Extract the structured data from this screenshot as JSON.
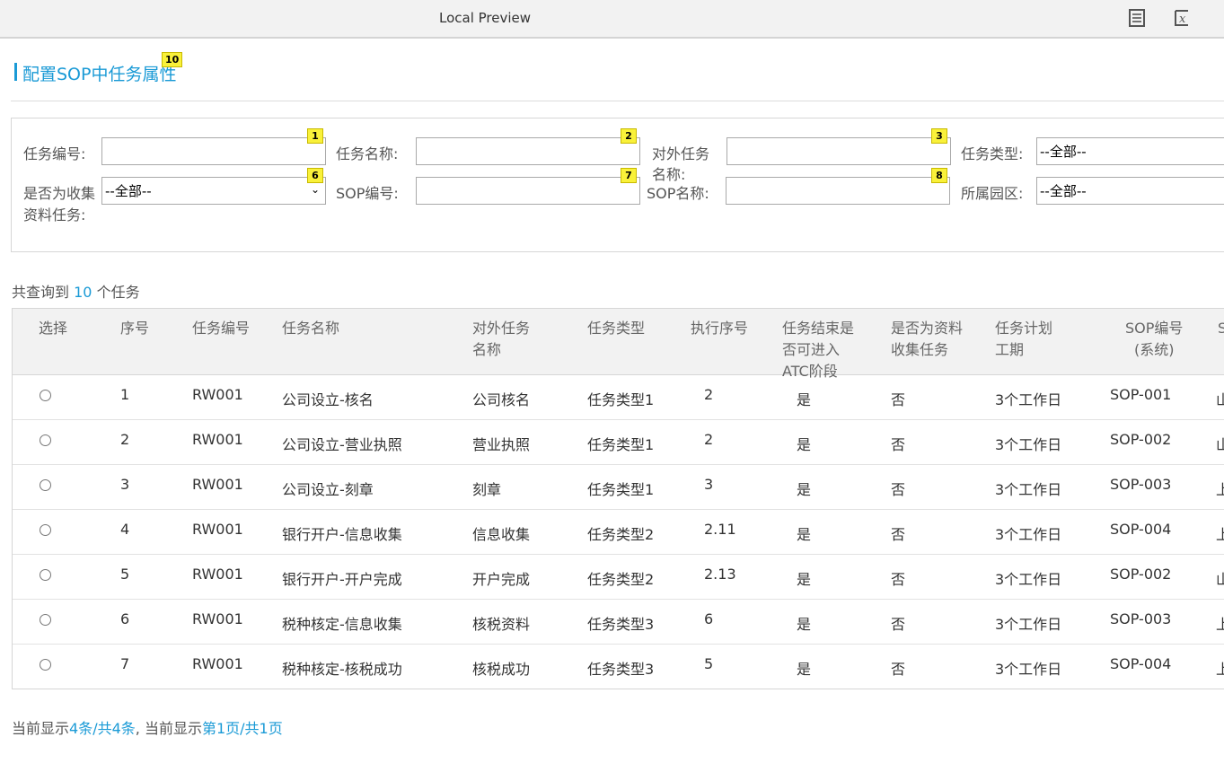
{
  "window": {
    "title": "Local Preview",
    "list_icon": "document-list-icon",
    "close_icon": "close-formula-icon"
  },
  "page": {
    "title": "配置SOP中任务属性",
    "title_badge": "10"
  },
  "search": {
    "task_no": {
      "label": "任务编号:",
      "value": "",
      "badge": "1"
    },
    "task_name": {
      "label": "任务名称:",
      "value": "",
      "badge": "2"
    },
    "external_task_name": {
      "label_line1": "对外任务",
      "label_line2": "名称:",
      "value": "",
      "badge": "3"
    },
    "task_type": {
      "label": "任务类型:",
      "selected": "--全部--"
    },
    "is_collect_task": {
      "label_line1": "是否为收集",
      "label_line2": "资料任务:",
      "selected": "--全部--",
      "badge": "6"
    },
    "sop_no": {
      "label": "SOP编号:",
      "value": "",
      "badge": "7"
    },
    "sop_name": {
      "label": "SOP名称:",
      "value": "",
      "badge": "8"
    },
    "park": {
      "label": "所属园区:",
      "selected": "--全部--"
    }
  },
  "result_count": {
    "prefix": "共查询到",
    "count": "10",
    "suffix": "个任务"
  },
  "table": {
    "headers": {
      "select": "选择",
      "seq": "序号",
      "task_no": "任务编号",
      "task_name": "任务名称",
      "external_name_1": "对外任务",
      "external_name_2": "名称",
      "task_type": "任务类型",
      "exec_seq": "执行序号",
      "atc_1": "任务结束是",
      "atc_2": "否可进入",
      "atc_3": "ATC阶段",
      "collect_1": "是否为资料",
      "collect_2": "收集任务",
      "period_1": "任务计划",
      "period_2": "工期",
      "sop_no_1": "SOP编号",
      "sop_no_2": "(系统)",
      "next": "S"
    },
    "rows": [
      {
        "seq": "1",
        "task_no": "RW001",
        "task_name": "公司设立-核名",
        "external_name": "公司核名",
        "task_type": "任务类型1",
        "exec_seq": "2",
        "atc": "是",
        "collect": "否",
        "period": "3个工作日",
        "sop_no": "SOP-001",
        "next": "山"
      },
      {
        "seq": "2",
        "task_no": "RW001",
        "task_name": "公司设立-营业执照",
        "external_name": "营业执照",
        "task_type": "任务类型1",
        "exec_seq": "2",
        "atc": "是",
        "collect": "否",
        "period": "3个工作日",
        "sop_no": "SOP-002",
        "next": "山"
      },
      {
        "seq": "3",
        "task_no": "RW001",
        "task_name": "公司设立-刻章",
        "external_name": "刻章",
        "task_type": "任务类型1",
        "exec_seq": "3",
        "atc": "是",
        "collect": "否",
        "period": "3个工作日",
        "sop_no": "SOP-003",
        "next": "上"
      },
      {
        "seq": "4",
        "task_no": "RW001",
        "task_name": "银行开户-信息收集",
        "external_name": "信息收集",
        "task_type": "任务类型2",
        "exec_seq": "2.11",
        "atc": "是",
        "collect": "否",
        "period": "3个工作日",
        "sop_no": "SOP-004",
        "next": "上"
      },
      {
        "seq": "5",
        "task_no": "RW001",
        "task_name": "银行开户-开户完成",
        "external_name": "开户完成",
        "task_type": "任务类型2",
        "exec_seq": "2.13",
        "atc": "是",
        "collect": "否",
        "period": "3个工作日",
        "sop_no": "SOP-002",
        "next": "山"
      },
      {
        "seq": "6",
        "task_no": "RW001",
        "task_name": "税种核定-信息收集",
        "external_name": "核税资料",
        "task_type": "任务类型3",
        "exec_seq": "6",
        "atc": "是",
        "collect": "否",
        "period": "3个工作日",
        "sop_no": "SOP-003",
        "next": "上"
      },
      {
        "seq": "7",
        "task_no": "RW001",
        "task_name": "税种核定-核税成功",
        "external_name": "核税成功",
        "task_type": "任务类型3",
        "exec_seq": "5",
        "atc": "是",
        "collect": "否",
        "period": "3个工作日",
        "sop_no": "SOP-004",
        "next": "上"
      }
    ]
  },
  "footer": {
    "prefix1": "当前显示",
    "records": "4条/共4条",
    "sep": ", 当前显示",
    "pages": "第1页/共1页"
  }
}
